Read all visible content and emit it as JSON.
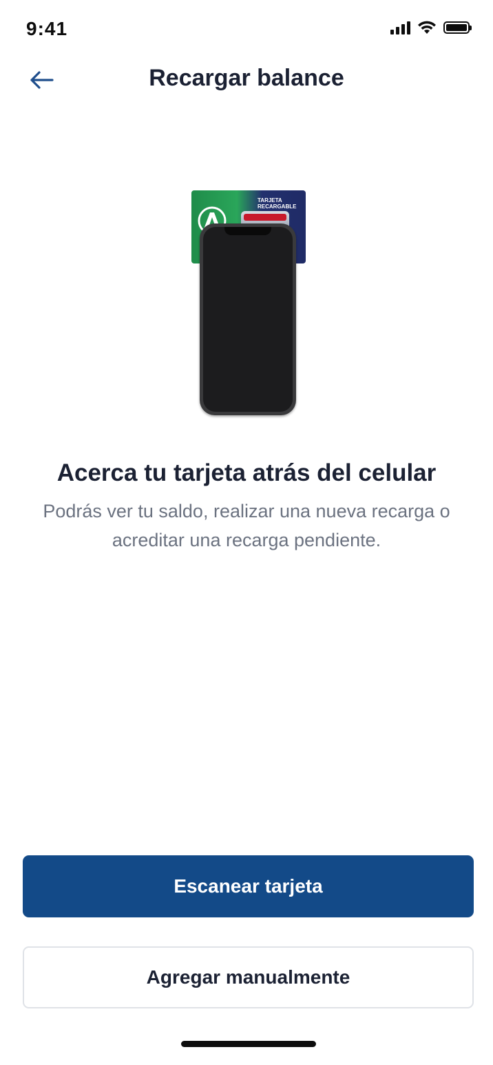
{
  "status_bar": {
    "time": "9:41",
    "icons": [
      "cellular-signal-icon",
      "wifi-icon",
      "battery-icon"
    ]
  },
  "header": {
    "back_icon": "arrow-left-icon",
    "title": "Recargar balance"
  },
  "illustration": {
    "card_label": "TARJETA RECARGABLE"
  },
  "main": {
    "headline": "Acerca tu tarjeta atrás del celular",
    "description": "Podrás ver tu saldo, realizar una nueva recarga o acreditar una recarga pendiente."
  },
  "actions": {
    "primary_label": "Escanear tarjeta",
    "secondary_label": "Agregar manualmente"
  },
  "colors": {
    "primary": "#134a88",
    "text_dark": "#1b2133",
    "text_muted": "#6b7280",
    "back_icon": "#1f4e8c"
  }
}
